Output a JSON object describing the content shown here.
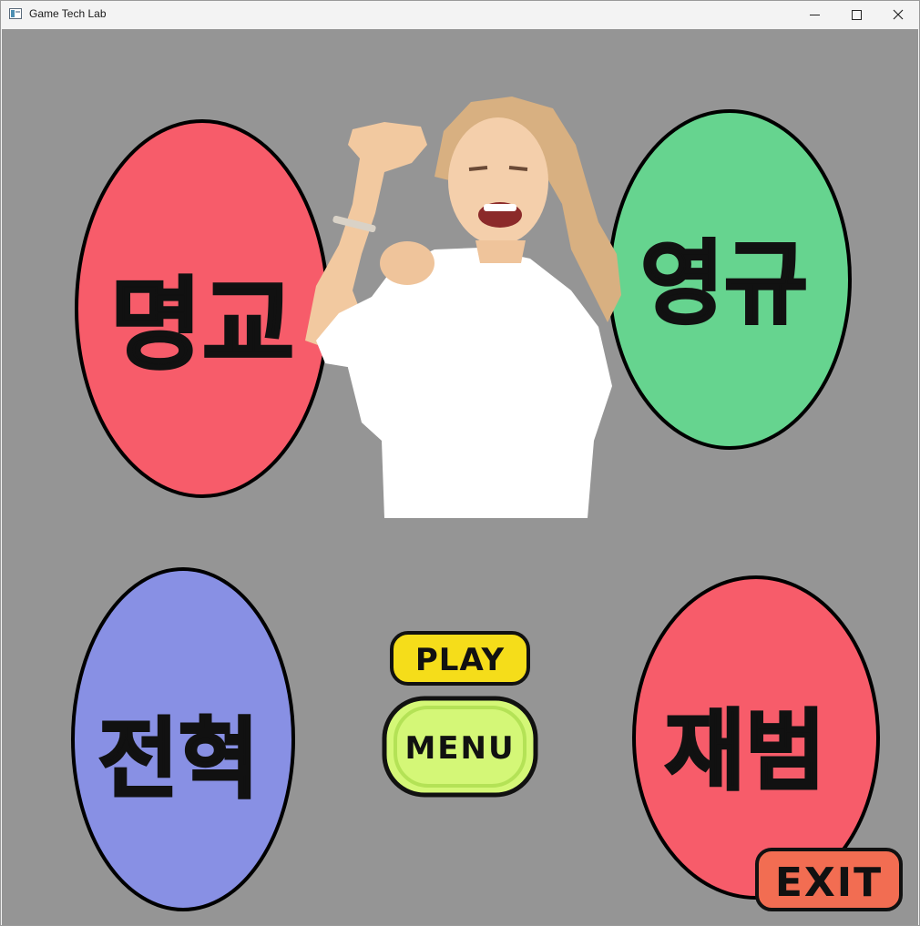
{
  "window": {
    "title": "Game Tech Lab",
    "controls": {
      "minimize": "minimize",
      "maximize": "maximize",
      "close": "close"
    }
  },
  "game": {
    "background_color": "#959595",
    "characters": [
      {
        "label": "명교",
        "color": "#f75c6a"
      },
      {
        "label": "영규",
        "color": "#66d48f"
      },
      {
        "label": "전혁",
        "color": "#8890e4"
      },
      {
        "label": "재범",
        "color": "#f75c6a"
      }
    ],
    "buttons": {
      "play": {
        "label": "PLAY",
        "color": "#f5dd1a"
      },
      "menu": {
        "label": "MENU",
        "color": "#d4f777"
      },
      "exit": {
        "label": "EXIT",
        "color": "#f26d52"
      }
    },
    "portrait": {
      "icon": "cheering-woman-figure"
    }
  }
}
